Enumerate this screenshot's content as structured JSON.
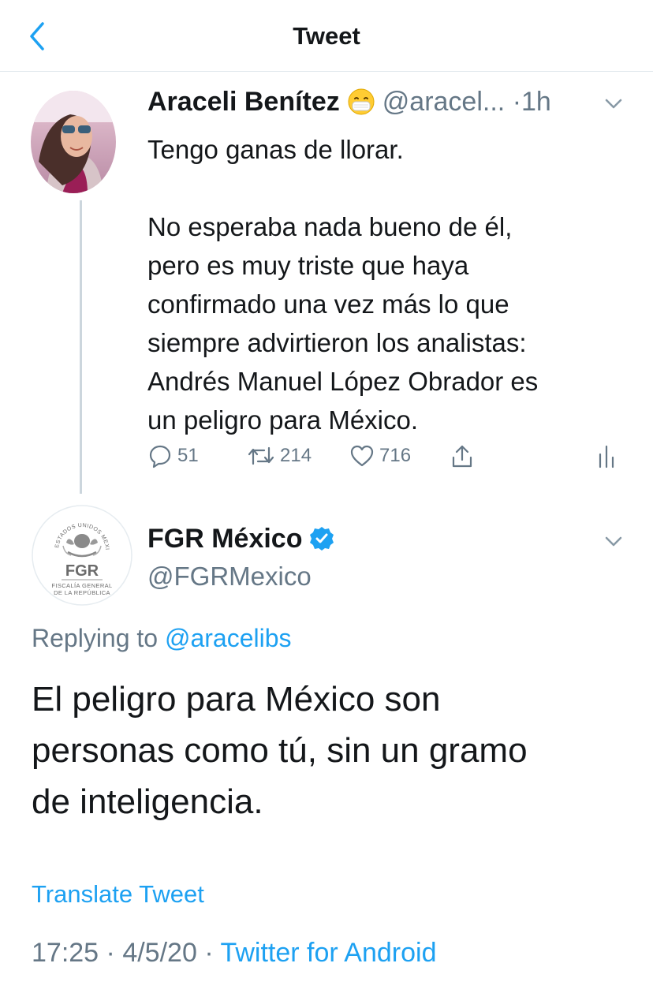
{
  "header": {
    "title": "Tweet",
    "back_icon": "chevron-left-icon"
  },
  "colors": {
    "accent": "#1da1f2",
    "secondary_text": "#657786",
    "primary_text": "#14171a",
    "divider": "#e1e8ed"
  },
  "original_tweet": {
    "author_name": "Araceli Benítez",
    "author_emoji": "face-with-medical-mask",
    "handle": "@aracel...",
    "separator": "·",
    "time": "1h",
    "text_line1": "Tengo ganas de llorar.",
    "text_para2": [
      "No esperaba nada bueno de él,",
      "pero es muy triste que haya",
      "confirmado una vez más lo que",
      "siempre advirtieron los analistas:",
      "Andrés Manuel López Obrador es",
      "un peligro para México."
    ],
    "replies": "51",
    "retweets": "214",
    "likes": "716"
  },
  "reply_tweet": {
    "author_name": "FGR México",
    "handle": "@FGRMexico",
    "avatar_lettering": "FGR",
    "avatar_sub1": "FISCALÍA GENERAL",
    "avatar_sub2": "DE LA REPÚBLICA",
    "avatar_ring": "ESTADOS UNIDOS MEXICANOS",
    "replying_prefix": "Replying to",
    "replying_to": "@aracelibs",
    "text_lines": [
      "El peligro para México son",
      "personas como tú, sin un gramo",
      "de inteligencia."
    ],
    "translate_label": "Translate Tweet",
    "time": "17:25",
    "date": "4/5/20",
    "dot": "·",
    "source": "Twitter for Android"
  }
}
